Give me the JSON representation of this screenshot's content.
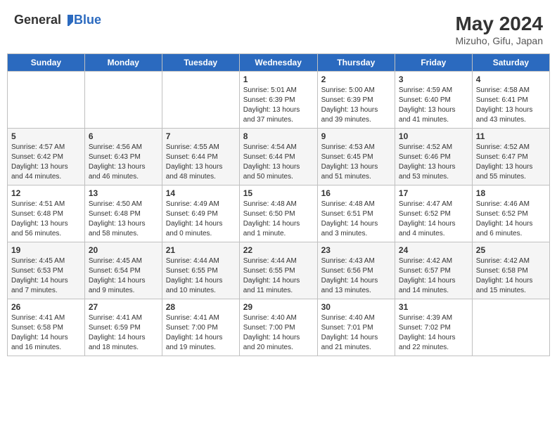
{
  "header": {
    "logo_general": "General",
    "logo_blue": "Blue",
    "month_year": "May 2024",
    "location": "Mizuho, Gifu, Japan"
  },
  "weekdays": [
    "Sunday",
    "Monday",
    "Tuesday",
    "Wednesday",
    "Thursday",
    "Friday",
    "Saturday"
  ],
  "weeks": [
    [
      {
        "day": "",
        "info": ""
      },
      {
        "day": "",
        "info": ""
      },
      {
        "day": "",
        "info": ""
      },
      {
        "day": "1",
        "info": "Sunrise: 5:01 AM\nSunset: 6:39 PM\nDaylight: 13 hours and 37 minutes."
      },
      {
        "day": "2",
        "info": "Sunrise: 5:00 AM\nSunset: 6:39 PM\nDaylight: 13 hours and 39 minutes."
      },
      {
        "day": "3",
        "info": "Sunrise: 4:59 AM\nSunset: 6:40 PM\nDaylight: 13 hours and 41 minutes."
      },
      {
        "day": "4",
        "info": "Sunrise: 4:58 AM\nSunset: 6:41 PM\nDaylight: 13 hours and 43 minutes."
      }
    ],
    [
      {
        "day": "5",
        "info": "Sunrise: 4:57 AM\nSunset: 6:42 PM\nDaylight: 13 hours and 44 minutes."
      },
      {
        "day": "6",
        "info": "Sunrise: 4:56 AM\nSunset: 6:43 PM\nDaylight: 13 hours and 46 minutes."
      },
      {
        "day": "7",
        "info": "Sunrise: 4:55 AM\nSunset: 6:44 PM\nDaylight: 13 hours and 48 minutes."
      },
      {
        "day": "8",
        "info": "Sunrise: 4:54 AM\nSunset: 6:44 PM\nDaylight: 13 hours and 50 minutes."
      },
      {
        "day": "9",
        "info": "Sunrise: 4:53 AM\nSunset: 6:45 PM\nDaylight: 13 hours and 51 minutes."
      },
      {
        "day": "10",
        "info": "Sunrise: 4:52 AM\nSunset: 6:46 PM\nDaylight: 13 hours and 53 minutes."
      },
      {
        "day": "11",
        "info": "Sunrise: 4:52 AM\nSunset: 6:47 PM\nDaylight: 13 hours and 55 minutes."
      }
    ],
    [
      {
        "day": "12",
        "info": "Sunrise: 4:51 AM\nSunset: 6:48 PM\nDaylight: 13 hours and 56 minutes."
      },
      {
        "day": "13",
        "info": "Sunrise: 4:50 AM\nSunset: 6:48 PM\nDaylight: 13 hours and 58 minutes."
      },
      {
        "day": "14",
        "info": "Sunrise: 4:49 AM\nSunset: 6:49 PM\nDaylight: 14 hours and 0 minutes."
      },
      {
        "day": "15",
        "info": "Sunrise: 4:48 AM\nSunset: 6:50 PM\nDaylight: 14 hours and 1 minute."
      },
      {
        "day": "16",
        "info": "Sunrise: 4:48 AM\nSunset: 6:51 PM\nDaylight: 14 hours and 3 minutes."
      },
      {
        "day": "17",
        "info": "Sunrise: 4:47 AM\nSunset: 6:52 PM\nDaylight: 14 hours and 4 minutes."
      },
      {
        "day": "18",
        "info": "Sunrise: 4:46 AM\nSunset: 6:52 PM\nDaylight: 14 hours and 6 minutes."
      }
    ],
    [
      {
        "day": "19",
        "info": "Sunrise: 4:45 AM\nSunset: 6:53 PM\nDaylight: 14 hours and 7 minutes."
      },
      {
        "day": "20",
        "info": "Sunrise: 4:45 AM\nSunset: 6:54 PM\nDaylight: 14 hours and 9 minutes."
      },
      {
        "day": "21",
        "info": "Sunrise: 4:44 AM\nSunset: 6:55 PM\nDaylight: 14 hours and 10 minutes."
      },
      {
        "day": "22",
        "info": "Sunrise: 4:44 AM\nSunset: 6:55 PM\nDaylight: 14 hours and 11 minutes."
      },
      {
        "day": "23",
        "info": "Sunrise: 4:43 AM\nSunset: 6:56 PM\nDaylight: 14 hours and 13 minutes."
      },
      {
        "day": "24",
        "info": "Sunrise: 4:42 AM\nSunset: 6:57 PM\nDaylight: 14 hours and 14 minutes."
      },
      {
        "day": "25",
        "info": "Sunrise: 4:42 AM\nSunset: 6:58 PM\nDaylight: 14 hours and 15 minutes."
      }
    ],
    [
      {
        "day": "26",
        "info": "Sunrise: 4:41 AM\nSunset: 6:58 PM\nDaylight: 14 hours and 16 minutes."
      },
      {
        "day": "27",
        "info": "Sunrise: 4:41 AM\nSunset: 6:59 PM\nDaylight: 14 hours and 18 minutes."
      },
      {
        "day": "28",
        "info": "Sunrise: 4:41 AM\nSunset: 7:00 PM\nDaylight: 14 hours and 19 minutes."
      },
      {
        "day": "29",
        "info": "Sunrise: 4:40 AM\nSunset: 7:00 PM\nDaylight: 14 hours and 20 minutes."
      },
      {
        "day": "30",
        "info": "Sunrise: 4:40 AM\nSunset: 7:01 PM\nDaylight: 14 hours and 21 minutes."
      },
      {
        "day": "31",
        "info": "Sunrise: 4:39 AM\nSunset: 7:02 PM\nDaylight: 14 hours and 22 minutes."
      },
      {
        "day": "",
        "info": ""
      }
    ]
  ]
}
